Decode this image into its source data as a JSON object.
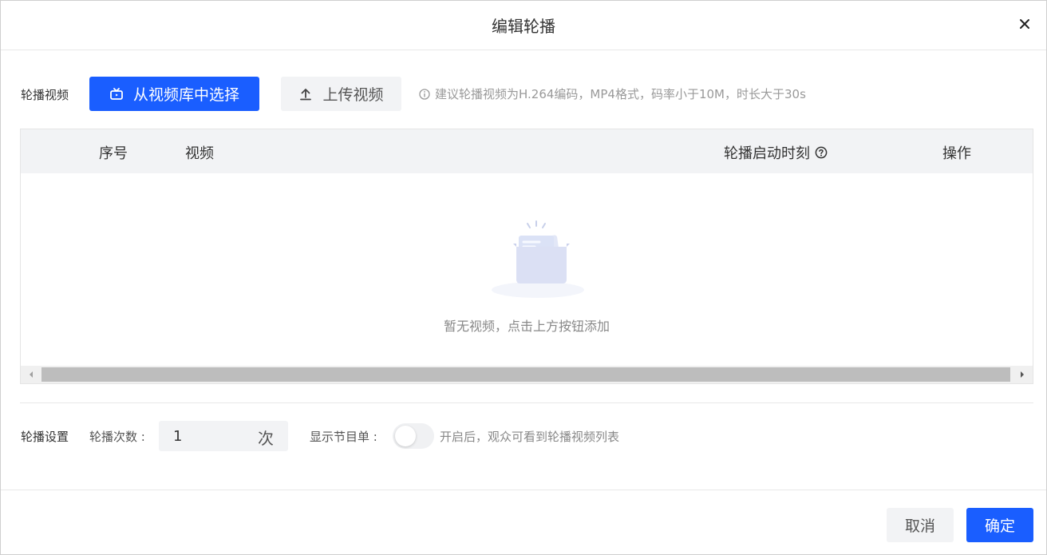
{
  "dialog": {
    "title": "编辑轮播",
    "close_icon": "close-icon"
  },
  "video_section": {
    "label": "轮播视频",
    "select_button": {
      "label": "从视频库中选择",
      "icon": "video-library-icon"
    },
    "upload_button": {
      "label": "上传视频",
      "icon": "upload-icon"
    },
    "hint": {
      "icon": "info-circle-icon",
      "text": "建议轮播视频为H.264编码，MP4格式，码率小于10M，时长大于30s"
    }
  },
  "table": {
    "columns": [
      {
        "label": "序号"
      },
      {
        "label": "视频"
      },
      {
        "label": "轮播启动时刻",
        "icon": "help-circle-icon"
      },
      {
        "label": "操作"
      }
    ],
    "rows": [],
    "empty_text": "暂无视频，点击上方按钮添加",
    "empty_icon": "empty-folder-icon"
  },
  "settings": {
    "label": "轮播设置",
    "count_label": "轮播次数 :",
    "count_value": "1",
    "count_suffix": "次",
    "playlist_label": "显示节目单 :",
    "playlist_enabled": false,
    "playlist_hint": "开启后，观众可看到轮播视频列表"
  },
  "footer": {
    "cancel_label": "取消",
    "confirm_label": "确定"
  },
  "colors": {
    "primary": "#1a5eff",
    "secondary_bg": "#f2f3f5"
  }
}
